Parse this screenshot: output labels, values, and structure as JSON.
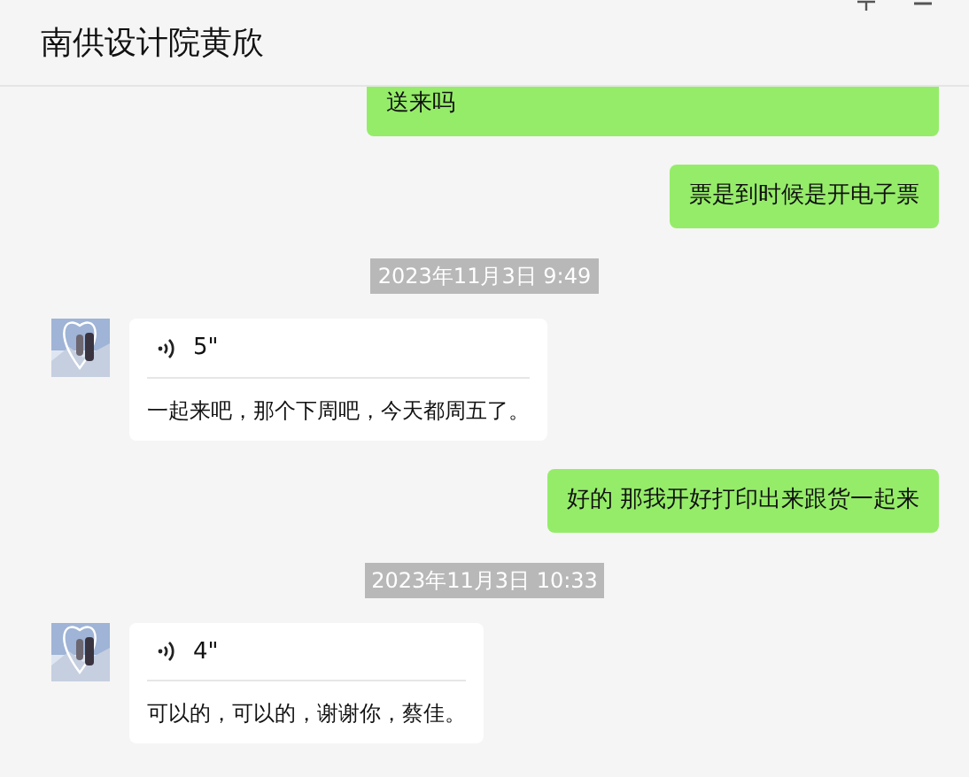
{
  "header": {
    "title": "南供设计院黄欣"
  },
  "messages": [
    {
      "kind": "text",
      "outgoing": true,
      "text": "送来吗"
    },
    {
      "kind": "text",
      "outgoing": true,
      "text": "票是到时候是开电子票"
    },
    {
      "kind": "time",
      "text": "2023年11月3日 9:49"
    },
    {
      "kind": "voice",
      "outgoing": false,
      "duration": "5\"",
      "transcript": "一起来吧，那个下周吧，今天都周五了。"
    },
    {
      "kind": "text",
      "outgoing": true,
      "text": "好的 那我开好打印出来跟货一起来"
    },
    {
      "kind": "time",
      "text": "2023年11月3日 10:33"
    },
    {
      "kind": "voice",
      "outgoing": false,
      "duration": "4\"",
      "transcript": "可以的，可以的，谢谢你，蔡佳。"
    }
  ]
}
